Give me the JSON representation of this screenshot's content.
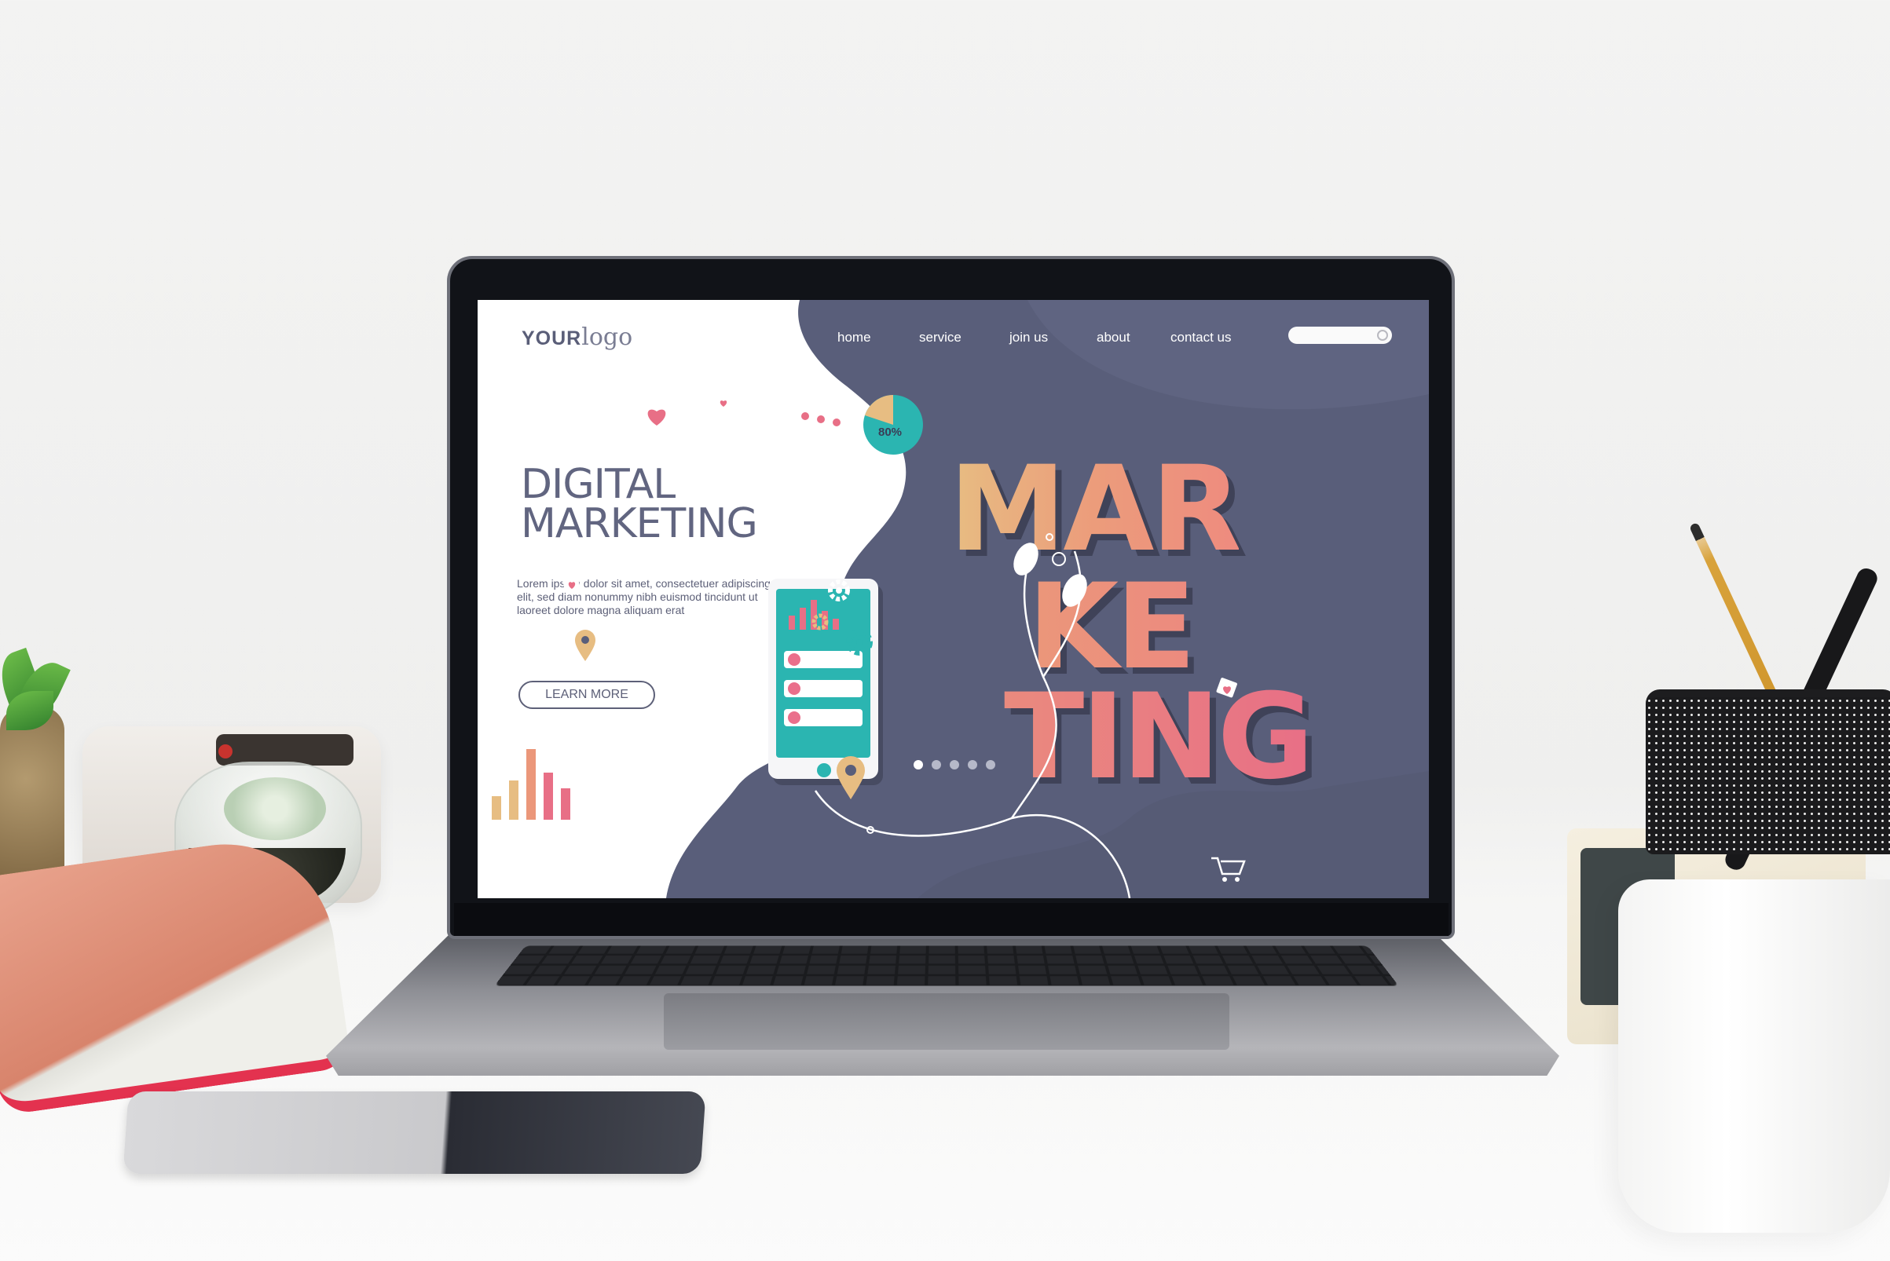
{
  "site": {
    "logo_bold": "YOUR",
    "logo_light": "logo",
    "nav": [
      "home",
      "service",
      "join us",
      "about",
      "contact us"
    ],
    "search": {
      "placeholder": ""
    },
    "headline_line1": "DIGITAL",
    "headline_line2": "MARKETING",
    "body_line1": "Lorem ipsum dolor sit amet, consectetuer adipiscing",
    "body_line2": "elit, sed diam nonummy nibh euismod tincidunt ut",
    "body_line3": "laoreet dolore magna aliquam erat",
    "cta_label": "LEARN MORE",
    "hero_word_1": "MAR",
    "hero_word_2": "KE",
    "hero_word_3": "TING",
    "pie_label": "80%",
    "pie_value_percent": 80,
    "carousel": {
      "slide_count": 5,
      "active_index": 0
    },
    "colors": {
      "panel": "#595e7a",
      "accent_teal": "#2bb5b1",
      "accent_pink": "#e86f86",
      "accent_gold": "#e7bd82",
      "text_dark": "#5d6078"
    }
  },
  "icons": [
    "search-icon",
    "heart-bubble-icon",
    "cart-icon",
    "chat-bubble-icon",
    "gear-icon",
    "location-pin-icon",
    "earphones-icon",
    "pie-chart-icon",
    "bar-chart-icon"
  ]
}
